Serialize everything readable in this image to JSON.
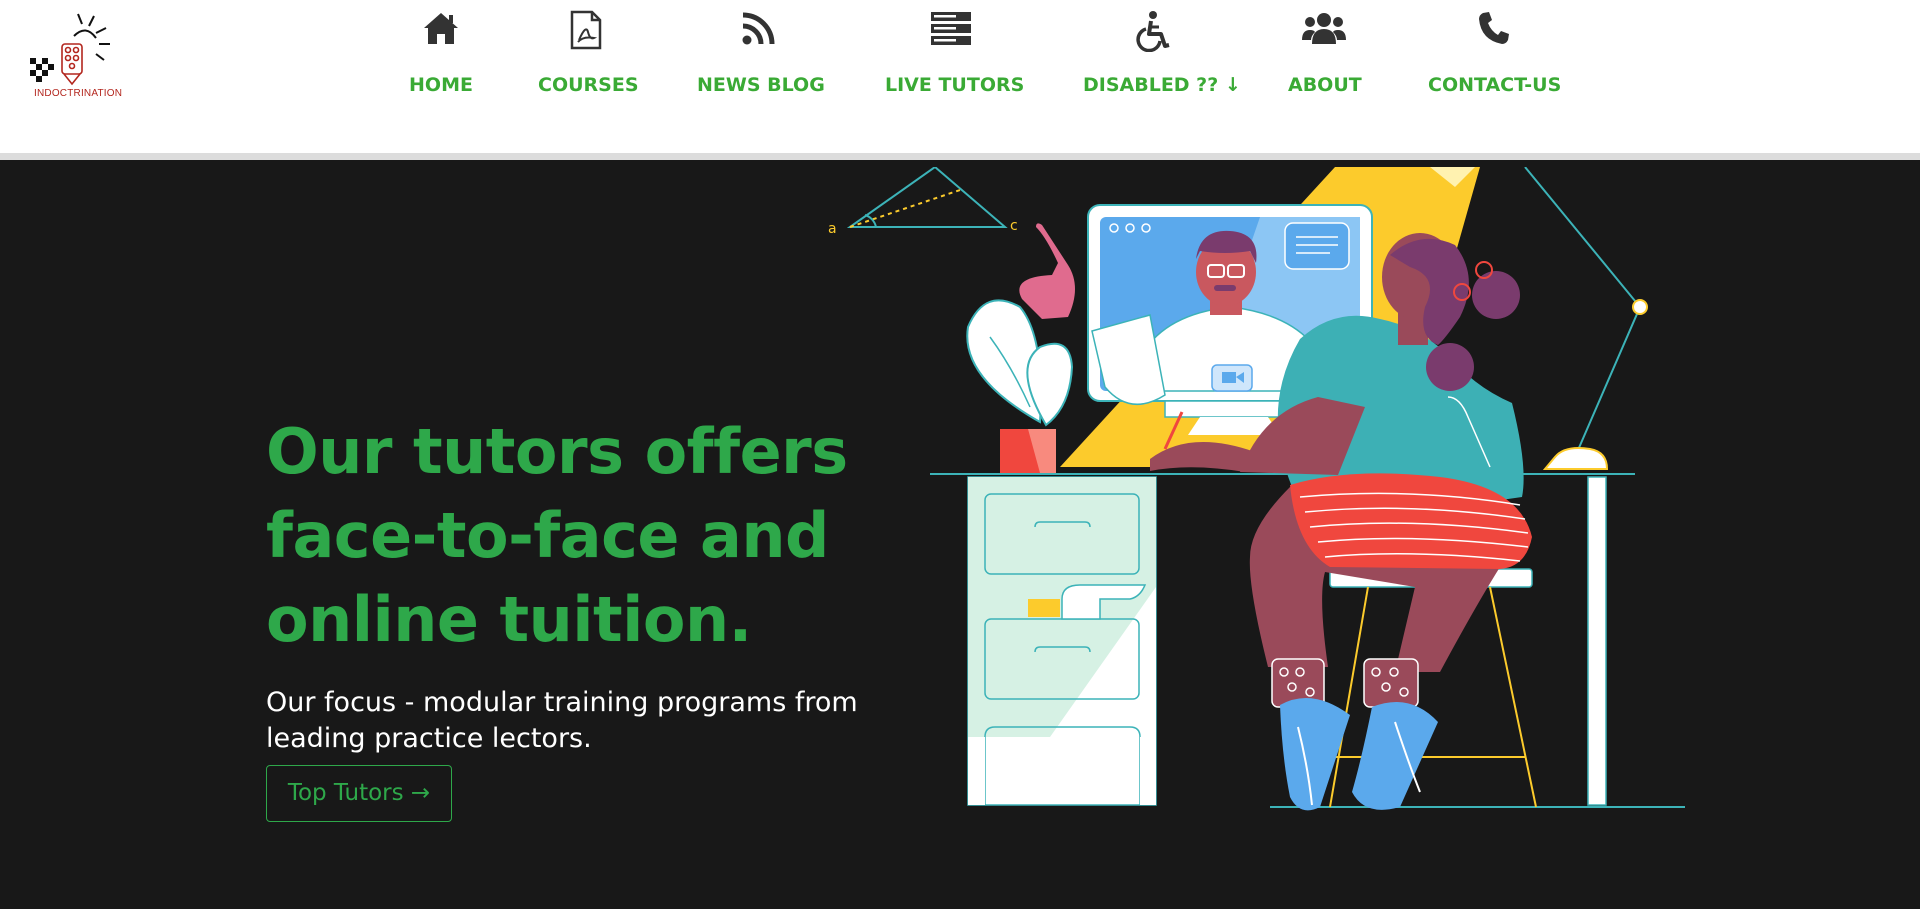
{
  "brand": {
    "logo_text": "INDOCTRINATION"
  },
  "nav": [
    {
      "label": "HOME",
      "icon": "home-icon"
    },
    {
      "label": "COURSES",
      "icon": "pdf-file-icon"
    },
    {
      "label": "NEWS BLOG",
      "icon": "rss-icon"
    },
    {
      "label": "LIVE TUTORS",
      "icon": "server-list-icon"
    },
    {
      "label": "DISABLED ?? ↓",
      "icon": "wheelchair-icon"
    },
    {
      "label": "ABOUT",
      "icon": "users-icon"
    },
    {
      "label": "CONTACT-US",
      "icon": "phone-icon"
    }
  ],
  "hero": {
    "headline_line1": "Our tutors offers",
    "headline_line2": "face-to-face and",
    "headline_line3": "online tuition.",
    "subtitle": "Our focus - modular training programs from leading practice lectors.",
    "cta_label": "Top Tutors →"
  },
  "colors": {
    "accent_green": "#2ea84a",
    "nav_green": "#3aaa35",
    "hero_background": "#181818",
    "header_background": "#ffffff",
    "logo_red": "#b3261e"
  }
}
